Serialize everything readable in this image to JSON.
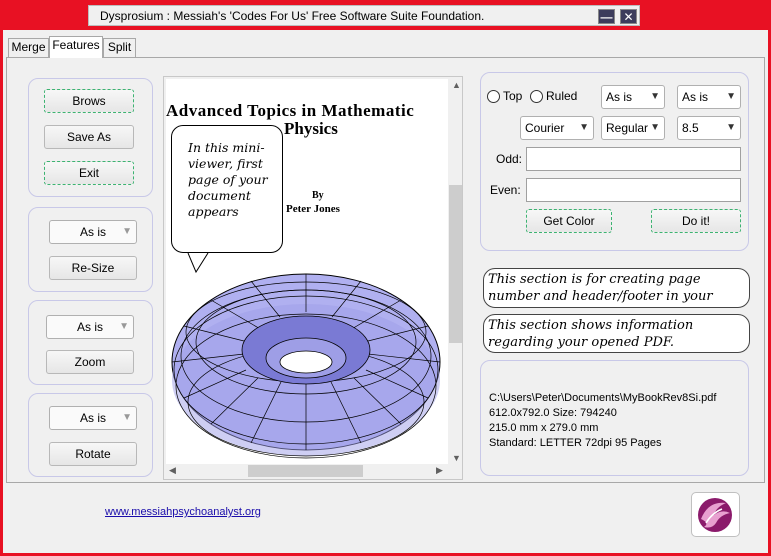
{
  "window": {
    "title": "Dysprosium : Messiah's 'Codes For Us' Free Software Suite Foundation.",
    "minimize_glyph": "—",
    "close_glyph": "✕"
  },
  "tabs": [
    {
      "label": "Merge"
    },
    {
      "label": "Features",
      "active": true
    },
    {
      "label": "Split"
    }
  ],
  "left_panel": {
    "browse_label": "Brows",
    "save_as_label": "Save As",
    "exit_label": "Exit",
    "resize": {
      "select_value": "As is",
      "button_label": "Re-Size"
    },
    "zoom": {
      "select_value": "As is",
      "button_label": "Zoom"
    },
    "rotate": {
      "select_value": "As is",
      "button_label": "Rotate"
    }
  },
  "viewer": {
    "doc_title_line1": "Advanced Topics in Mathematic",
    "doc_title_line2": "Physics",
    "by": "By",
    "author": "Peter Jones",
    "callout": "In this mini-viewer, first page of your document appears",
    "torus_fill": "#b0b0f0"
  },
  "header_footer": {
    "top_label": "Top",
    "ruled_label": "Ruled",
    "select_a": "As is",
    "select_b": "As is",
    "font_family": "Courier",
    "font_style": "Regular",
    "font_size": "8.5",
    "odd_label": "Odd:",
    "even_label": "Even:",
    "odd_value": "",
    "even_value": "",
    "get_color_label": "Get Color",
    "do_it_label": "Do it!"
  },
  "notes": {
    "header_note": "This section is for creating page number and header/footer in your existing PDF",
    "info_note": "This section shows information regarding your opened PDF."
  },
  "pdf_info": {
    "path": "C:\\Users\\Peter\\Documents\\MyBookRev8Si.pdf",
    "size_pts": "612.0x792.0 Size: 794240",
    "size_mm": "215.0 mm x 279.0 mm",
    "standard": "Standard: LETTER 72dpi 95 Pages"
  },
  "footer": {
    "link": "www.messiahpsychoanalyst.org",
    "logo_icon": "phoenix-logo-icon"
  },
  "colors": {
    "frame": "#e81123",
    "group_border": "#c8c8e8",
    "focus_border": "#3cb371"
  }
}
